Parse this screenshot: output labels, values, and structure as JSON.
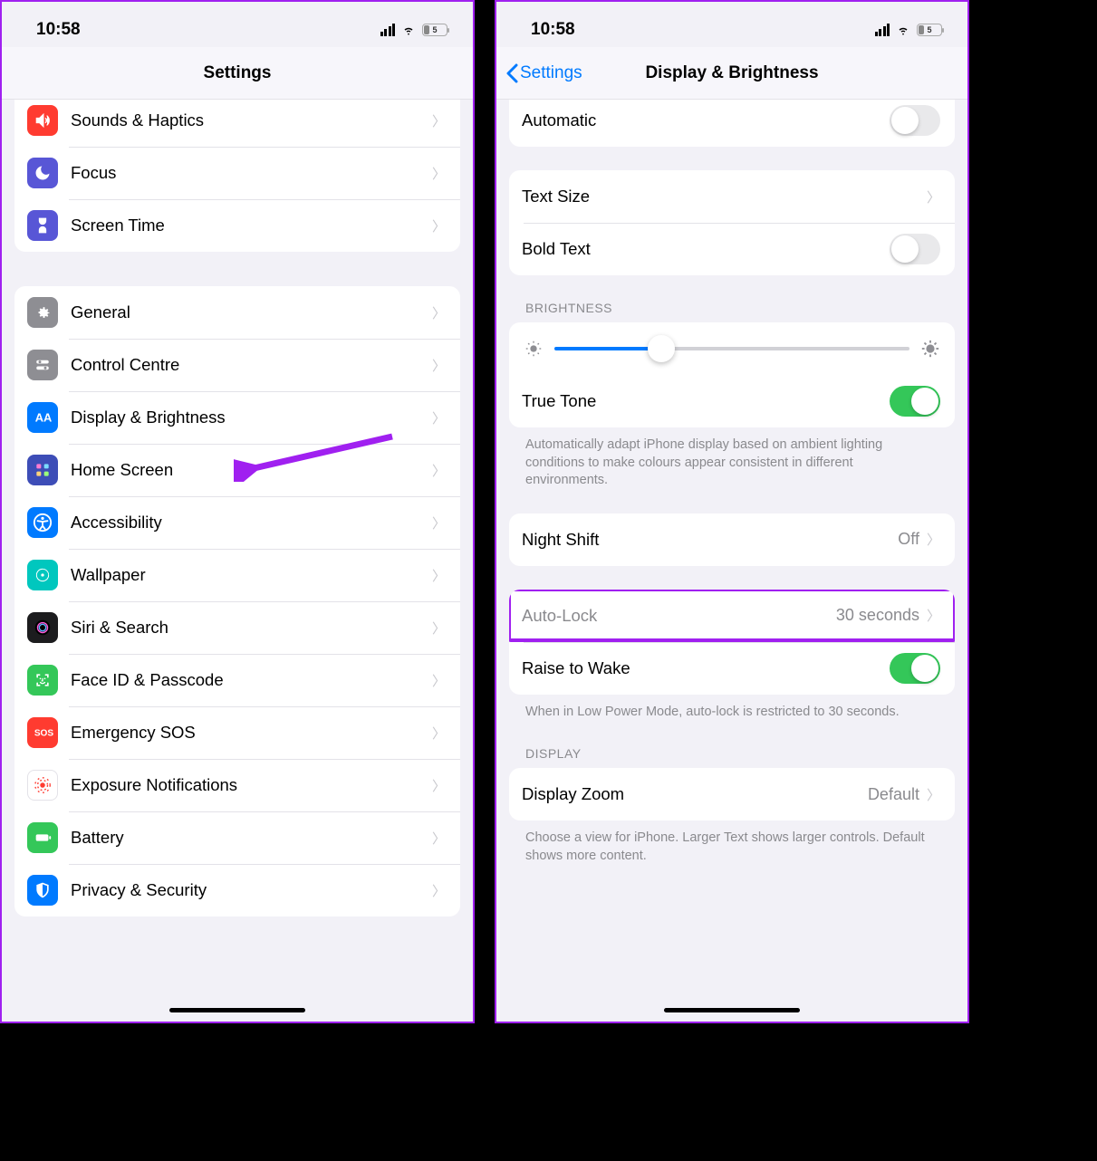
{
  "status": {
    "time": "10:58",
    "battery": "5"
  },
  "left": {
    "title": "Settings",
    "group1": [
      {
        "id": "sounds",
        "label": "Sounds & Haptics",
        "bg": "#ff3b30"
      },
      {
        "id": "focus",
        "label": "Focus",
        "bg": "#5856d6"
      },
      {
        "id": "screentime",
        "label": "Screen Time",
        "bg": "#5856d6"
      }
    ],
    "group2": [
      {
        "id": "general",
        "label": "General",
        "bg": "#8e8e93"
      },
      {
        "id": "controlcentre",
        "label": "Control Centre",
        "bg": "#8e8e93"
      },
      {
        "id": "display",
        "label": "Display & Brightness",
        "bg": "#007aff"
      },
      {
        "id": "homescreen",
        "label": "Home Screen",
        "bg": "#3d4db7"
      },
      {
        "id": "accessibility",
        "label": "Accessibility",
        "bg": "#007aff"
      },
      {
        "id": "wallpaper",
        "label": "Wallpaper",
        "bg": "#00c7be"
      },
      {
        "id": "siri",
        "label": "Siri & Search",
        "bg": "#1c1c1e"
      },
      {
        "id": "faceid",
        "label": "Face ID & Passcode",
        "bg": "#34c759"
      },
      {
        "id": "sos",
        "label": "Emergency SOS",
        "bg": "#ff3b30"
      },
      {
        "id": "exposure",
        "label": "Exposure Notifications",
        "bg": "#ffffff"
      },
      {
        "id": "battery",
        "label": "Battery",
        "bg": "#34c759"
      },
      {
        "id": "privacy",
        "label": "Privacy & Security",
        "bg": "#007aff"
      }
    ]
  },
  "right": {
    "back": "Settings",
    "title": "Display & Brightness",
    "automatic": "Automatic",
    "textsize": "Text Size",
    "boldtext": "Bold Text",
    "brightness_header": "BRIGHTNESS",
    "truetone": "True Tone",
    "truetone_footer": "Automatically adapt iPhone display based on ambient lighting conditions to make colours appear consistent in different environments.",
    "nightshift": "Night Shift",
    "nightshift_value": "Off",
    "autolock": "Auto-Lock",
    "autolock_value": "30 seconds",
    "raisetowake": "Raise to Wake",
    "lowpower_footer": "When in Low Power Mode, auto-lock is restricted to 30 seconds.",
    "display_header": "DISPLAY",
    "displayzoom": "Display Zoom",
    "displayzoom_value": "Default",
    "zoom_footer": "Choose a view for iPhone. Larger Text shows larger controls. Default shows more content."
  }
}
